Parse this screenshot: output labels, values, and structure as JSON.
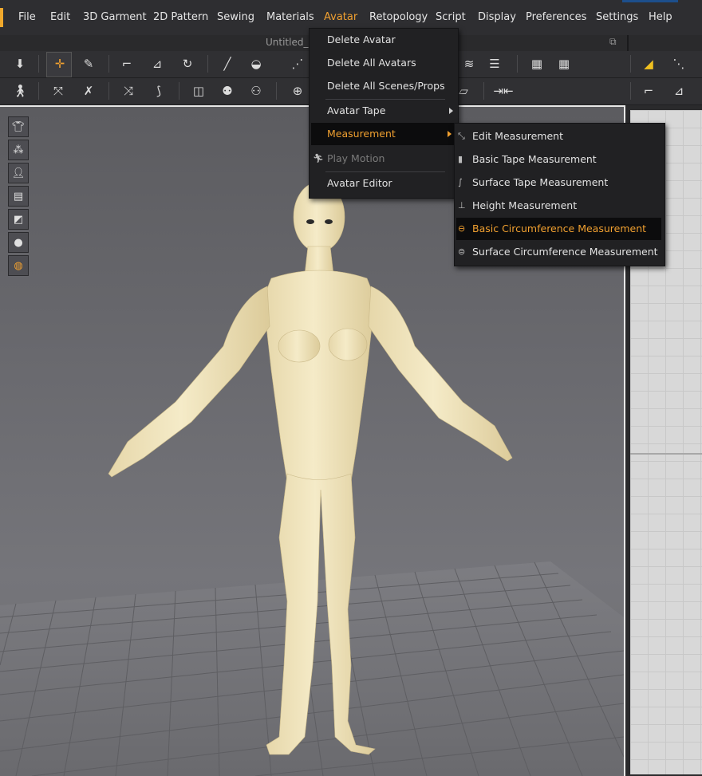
{
  "menubar": {
    "items": [
      "File",
      "Edit",
      "3D Garment",
      "2D Pattern",
      "Sewing",
      "Materials",
      "Avatar",
      "Retopology",
      "Script",
      "Display",
      "Preferences",
      "Settings",
      "Help"
    ],
    "active": "Avatar"
  },
  "document": {
    "title": "Untitled_M",
    "popout_icon": "popout-icon"
  },
  "avatar_menu": {
    "items": [
      {
        "label": "Delete Avatar"
      },
      {
        "label": "Delete All Avatars"
      },
      {
        "label": "Delete All Scenes/Props"
      },
      {
        "label": "Avatar Tape",
        "submenu": true
      },
      {
        "label": "Measurement",
        "submenu": true,
        "highlighted": true
      },
      {
        "label": "Play Motion",
        "disabled": true,
        "icon": "running-figure-icon"
      },
      {
        "label": "Avatar Editor"
      }
    ]
  },
  "measurement_menu": {
    "items": [
      {
        "label": "Edit Measurement",
        "icon": "edit-measure-icon"
      },
      {
        "label": "Basic Tape Measurement",
        "icon": "tape-icon"
      },
      {
        "label": "Surface Tape Measurement",
        "icon": "surface-tape-icon"
      },
      {
        "label": "Height Measurement",
        "icon": "height-icon"
      },
      {
        "label": "Basic Circumference Measurement",
        "icon": "circumference-icon",
        "highlighted": true
      },
      {
        "label": "Surface Circumference Measurement",
        "icon": "surface-circumference-icon"
      }
    ]
  },
  "toolbar1_icons": [
    "down-arrow-icon",
    "move-icon",
    "brush-icon",
    "fold-icon",
    "pin-icon",
    "rotate-icon",
    "needle-icon",
    "hanger-icon",
    "sew-icon",
    "stack-icon",
    "layers-icon",
    "grid-icon",
    "grid2-icon",
    "warning-icon",
    "points-icon"
  ],
  "toolbar2_icons": [
    "avatar-pose-icon",
    "pattern-edit-icon",
    "pattern-brush-icon",
    "arrange-icon",
    "zigzag-icon",
    "select-tool-icon",
    "shirt-icon",
    "shirt2-icon",
    "dot-icon",
    "ruler-icon",
    "align-icon",
    "sew-edit-icon",
    "fold-edit-icon"
  ],
  "side_tools": [
    "garment-view-icon",
    "particle-icon",
    "avatar-view-icon",
    "pattern-icon",
    "texture-icon",
    "avatar-head-icon",
    "globe-icon"
  ],
  "colors": {
    "accent": "#f0a030",
    "skin": "#f0e4c0"
  }
}
